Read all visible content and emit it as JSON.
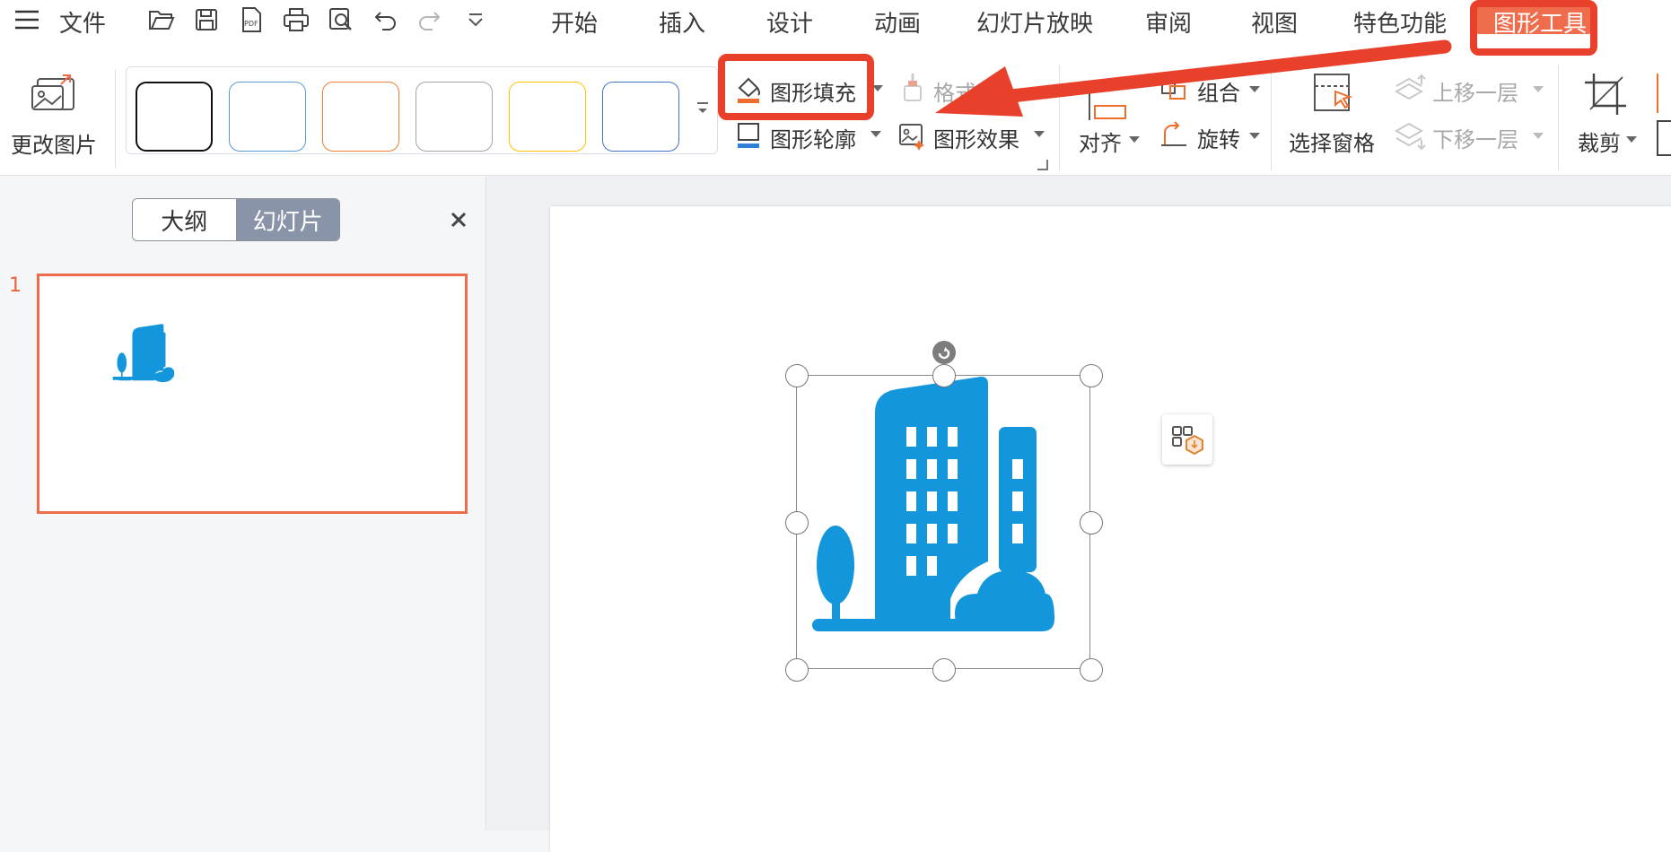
{
  "menubar": {
    "file_label": "文件",
    "tabs": [
      {
        "label": "开始"
      },
      {
        "label": "插入"
      },
      {
        "label": "设计"
      },
      {
        "label": "动画"
      },
      {
        "label": "幻灯片放映"
      },
      {
        "label": "审阅"
      },
      {
        "label": "视图"
      },
      {
        "label": "特色功能"
      },
      {
        "label": "图形工具"
      }
    ],
    "active_tab": "图形工具",
    "active_tab_color": "#ef6d4d"
  },
  "ribbon": {
    "change_picture": "更改图片",
    "shape_fill": "图形填充",
    "format_painter": "格式刷",
    "shape_outline": "图形轮廓",
    "shape_effects": "图形效果",
    "align": "对齐",
    "group": "组合",
    "rotate": "旋转",
    "selection_pane": "选择窗格",
    "bring_forward": "上移一层",
    "send_backward": "下移一层",
    "crop": "裁剪",
    "style_swatches": [
      {
        "border": "#111111"
      },
      {
        "border": "#5b9bd5"
      },
      {
        "border": "#ed7d31"
      },
      {
        "border": "#a5a5a5"
      },
      {
        "border": "#ffc000"
      },
      {
        "border": "#4472c4"
      }
    ]
  },
  "left_panel": {
    "outline_tab": "大纲",
    "slides_tab": "幻灯片",
    "slide_number": "1"
  },
  "colors": {
    "accent": "#ef6d4d",
    "annotation": "#e8402a",
    "icon_blue": "#1396db"
  }
}
